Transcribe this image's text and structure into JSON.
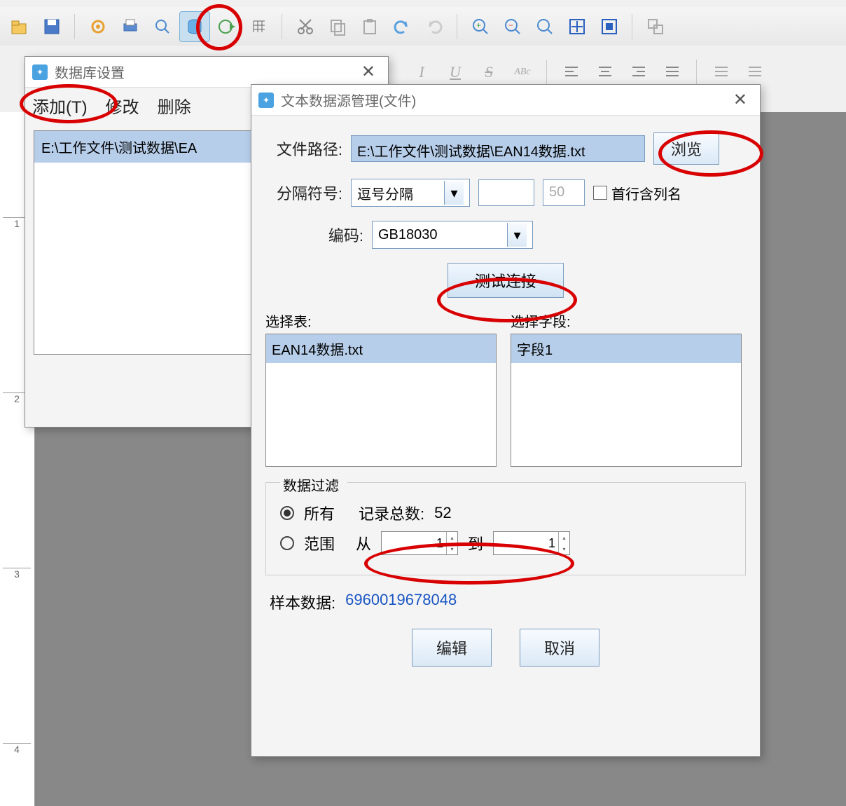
{
  "toolbar_icons": [
    "open",
    "save",
    "gear",
    "print",
    "search",
    "database",
    "globe-play",
    "grid",
    "cut",
    "copy",
    "paste",
    "undo",
    "redo",
    "zoom-in",
    "zoom-out",
    "zoom-fit",
    "fit-width",
    "fit-page",
    "group"
  ],
  "dlg1": {
    "title": "数据库设置",
    "menu": {
      "add": "添加(T)",
      "modify": "修改",
      "delete": "删除"
    },
    "list_item": "E:\\工作文件\\测试数据\\EA",
    "close_btn": "关闭"
  },
  "dlg2": {
    "title": "文本数据源管理(文件)",
    "labels": {
      "path": "文件路径:",
      "sep": "分隔符号:",
      "enc": "编码:",
      "sel_table": "选择表:",
      "sel_field": "选择字段:",
      "filter_title": "数据过滤",
      "all": "所有",
      "rec_total": "记录总数:",
      "range": "范围",
      "from": "从",
      "to": "到",
      "sample": "样本数据:",
      "first_row": "首行含列名"
    },
    "path_value": "E:\\工作文件\\测试数据\\EAN14数据.txt",
    "browse_btn": "浏览",
    "sep_value": "逗号分隔",
    "sep_num": "50",
    "enc_value": "GB18030",
    "test_btn": "测试连接",
    "table_item": "EAN14数据.txt",
    "field_item": "字段1",
    "rec_total_value": "52",
    "range_from": "1",
    "range_to": "1",
    "sample_value": "6960019678048",
    "edit_btn": "编辑",
    "cancel_btn": "取消"
  },
  "ruler": [
    "1",
    "2",
    "3",
    "4"
  ]
}
